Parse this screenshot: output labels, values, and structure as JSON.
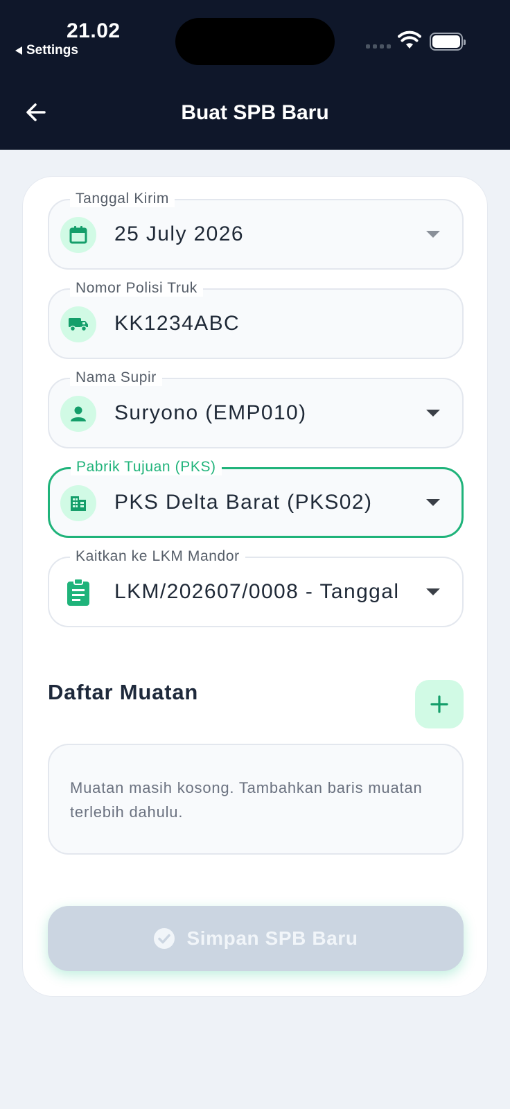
{
  "status_bar": {
    "time": "21.02",
    "back_app": "Settings"
  },
  "app_bar": {
    "title": "Buat SPB Baru"
  },
  "form": {
    "tanggal_kirim": {
      "label": "Tanggal Kirim",
      "value": "25 July 2026",
      "icon": "calendar-icon"
    },
    "nomor_polisi": {
      "label": "Nomor Polisi Truk",
      "value": "KK1234ABC",
      "icon": "truck-icon"
    },
    "nama_supir": {
      "label": "Nama Supir",
      "value": "Suryono (EMP010)",
      "icon": "person-icon"
    },
    "pabrik_tujuan": {
      "label": "Pabrik Tujuan (PKS)",
      "value": "PKS Delta Barat (PKS02)",
      "icon": "building-icon"
    },
    "lkm_mandor": {
      "label": "Kaitkan ke LKM Mandor",
      "value": "LKM/202607/0008 - Tanggal",
      "icon": "clipboard-icon"
    }
  },
  "muatan": {
    "title": "Daftar Muatan",
    "empty_text": "Muatan masih kosong. Tambahkan baris muatan terlebih dahulu."
  },
  "save_button": {
    "label": "Simpan SPB Baru"
  },
  "colors": {
    "header_bg": "#0f172a",
    "accent": "#1fb37a",
    "accent_light": "#d1fae5",
    "page_bg": "#eef2f7",
    "disabled_button": "#cbd5e1"
  }
}
